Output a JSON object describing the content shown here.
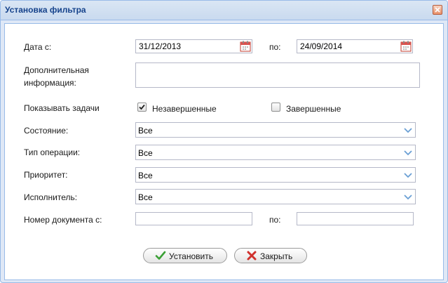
{
  "window": {
    "title": "Установка фильтра"
  },
  "form": {
    "date_from_label": "Дата с:",
    "date_from_value": "31/12/2013",
    "date_to_label": "по:",
    "date_to_value": "24/09/2014",
    "info_label_line1": "Дополнительная",
    "info_label_line2": "информация:",
    "info_value": "",
    "show_tasks_label": "Показывать задачи",
    "incomplete_label": "Незавершенные",
    "incomplete_checked": true,
    "complete_label": "Завершенные",
    "complete_checked": false,
    "state_label": "Состояние:",
    "state_value": "Все",
    "operation_type_label": "Тип операции:",
    "operation_type_value": "Все",
    "priority_label": "Приоритет:",
    "priority_value": "Все",
    "executor_label": "Исполнитель:",
    "executor_value": "Все",
    "docnum_from_label": "Номер документа с:",
    "docnum_from_value": "",
    "docnum_to_label": "по:",
    "docnum_to_value": ""
  },
  "buttons": {
    "apply_label": "Установить",
    "close_label": "Закрыть"
  },
  "icons": {
    "close": "close-icon",
    "calendar": "calendar-icon",
    "dropdown": "chevron-down-icon",
    "apply": "check-icon",
    "cancel": "x-icon"
  },
  "colors": {
    "title_text": "#15428b",
    "border": "#99bbe8",
    "panel_bg": "#dfe8f6"
  }
}
